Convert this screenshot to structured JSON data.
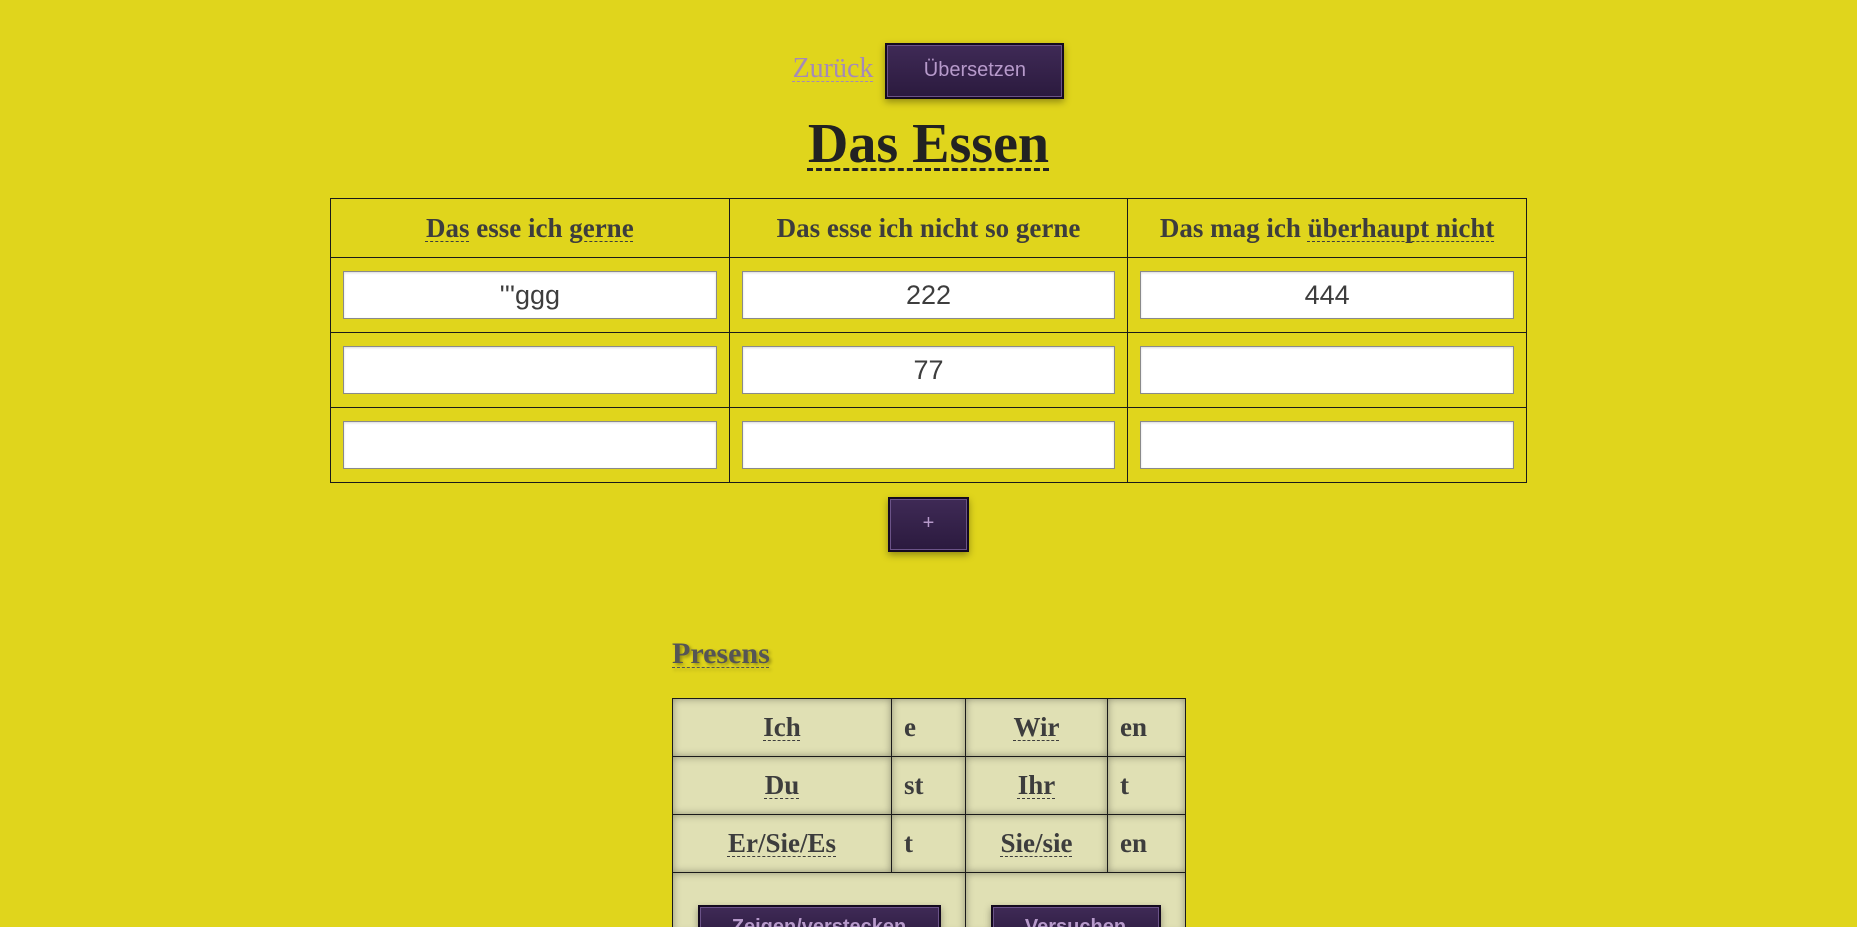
{
  "nav": {
    "back_label": "Zurück",
    "translate_label": "Übersetzen"
  },
  "page_title": "Das Essen",
  "food_table": {
    "headers": [
      {
        "word1": "Das",
        "mid": " esse ich ",
        "word2": "gerne",
        "tail": ""
      },
      {
        "text": "Das esse ich nicht so gerne"
      },
      {
        "lead": "Das mag ich ",
        "word2": "überhaupt nicht"
      }
    ],
    "rows": [
      [
        "'''ggg",
        "222",
        "444"
      ],
      [
        "",
        "77",
        ""
      ],
      [
        "",
        "",
        ""
      ]
    ],
    "add_row_label": "+"
  },
  "conjugation": {
    "title": "Presens",
    "rows": [
      {
        "p1": "Ich",
        "e1": "e",
        "p2": "Wir",
        "e2": "en"
      },
      {
        "p1": "Du",
        "e1": "st",
        "p2": "Ihr",
        "e2": "t"
      },
      {
        "p1": "Er/Sie/Es",
        "e1": "t",
        "p2": "Sie/sie",
        "e2": "en"
      }
    ],
    "show_hide_label": "Zeigen/verstecken",
    "try_label": "Versuchen"
  },
  "colors": {
    "background": "#e0d51c",
    "button": "#2b1a3e",
    "button_text": "#b79acb",
    "link": "#a58ab8"
  }
}
